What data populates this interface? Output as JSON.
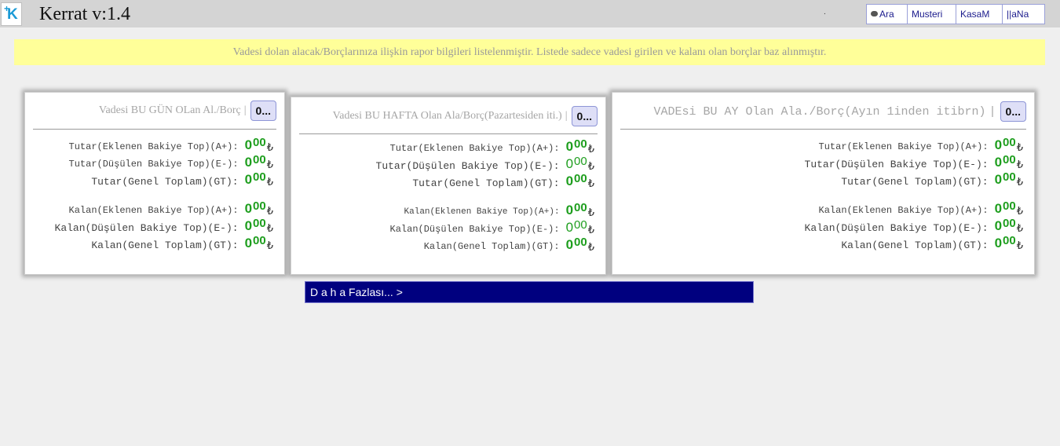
{
  "header": {
    "logo_letter": "K",
    "logo_plus": "+",
    "title": "Kerrat v:1.4",
    "dot": ".",
    "nav": [
      "Ara",
      "Musteri",
      "KasaM",
      "||aNa"
    ]
  },
  "notice": "Vadesi dolan alacak/Borçlarınıza ilişkin rapor bilgileri listelenmiştir. Listede sadece vadesi girilen ve kalanı olan borçlar baz alınmıştır.",
  "cards": [
    {
      "title": "Vadesi BU GÜN OLan Al./Borç",
      "sep": "|",
      "badge": "0...",
      "rows": [
        {
          "label": "Tutar(Eklenen Bakiye Top)(A+):",
          "int": "0",
          "dec": "00",
          "cur": "₺"
        },
        {
          "label": "Tutar(Düşülen Bakiye Top)(E-):",
          "int": "0",
          "dec": "00",
          "cur": "₺"
        },
        {
          "label": "Tutar(Genel Toplam)(GT):",
          "int": "0",
          "dec": "00",
          "cur": "₺"
        },
        {
          "label": "Kalan(Eklenen Bakiye Top)(A+):",
          "int": "0",
          "dec": "00",
          "cur": "₺"
        },
        {
          "label": "Kalan(Düşülen Bakiye Top)(E-):",
          "int": "0",
          "dec": "00",
          "cur": "₺"
        },
        {
          "label": "Kalan(Genel Toplam)(GT):",
          "int": "0",
          "dec": "00",
          "cur": "₺"
        }
      ]
    },
    {
      "title": "Vadesi BU HAFTA Olan Ala/Borç(Pazartesiden iti.)",
      "sep": "|",
      "badge": "0...",
      "rows": [
        {
          "label": "Tutar(Eklenen Bakiye Top)(A+):",
          "int": "0",
          "dec": "00",
          "cur": "₺"
        },
        {
          "label": "Tutar(Düşülen Bakiye Top)(E-):",
          "int": "0",
          "dec": "00",
          "cur": "₺"
        },
        {
          "label": "Tutar(Genel Toplam)(GT):",
          "int": "0",
          "dec": "00",
          "cur": "₺"
        },
        {
          "label": "Kalan(Eklenen Bakiye Top)(A+):",
          "int": "0",
          "dec": "00",
          "cur": "₺"
        },
        {
          "label": "Kalan(Düşülen Bakiye Top)(E-):",
          "int": "0",
          "dec": "00",
          "cur": "₺"
        },
        {
          "label": "Kalan(Genel Toplam)(GT):",
          "int": "0",
          "dec": "00",
          "cur": "₺"
        }
      ]
    },
    {
      "title": "VADEsi BU AY Olan Ala./Borç(Ayın 1inden itibrn)",
      "sep": "|",
      "badge": "0...",
      "rows": [
        {
          "label": "Tutar(Eklenen Bakiye Top)(A+):",
          "int": "0",
          "dec": "00",
          "cur": "₺"
        },
        {
          "label": "Tutar(Düşülen Bakiye Top)(E-):",
          "int": "0",
          "dec": "00",
          "cur": "₺"
        },
        {
          "label": "Tutar(Genel Toplam)(GT):",
          "int": "0",
          "dec": "00",
          "cur": "₺"
        },
        {
          "label": "Kalan(Eklenen Bakiye Top)(A+):",
          "int": "0",
          "dec": "00",
          "cur": "₺"
        },
        {
          "label": "Kalan(Düşülen Bakiye Top)(E-):",
          "int": "0",
          "dec": "00",
          "cur": "₺"
        },
        {
          "label": "Kalan(Genel Toplam)(GT):",
          "int": "0",
          "dec": "00",
          "cur": "₺"
        }
      ]
    }
  ],
  "more_label": "D a h a Fazlası... >",
  "colors": {
    "amount_green": "#1e9e1e",
    "notice_bg": "#ffff99",
    "more_bg": "#00007f",
    "nav_text": "#1a1a8c",
    "badge_bg": "#dedff7"
  },
  "icons": {
    "logo": "kerrat-logo-icon",
    "search": "eye-icon"
  }
}
